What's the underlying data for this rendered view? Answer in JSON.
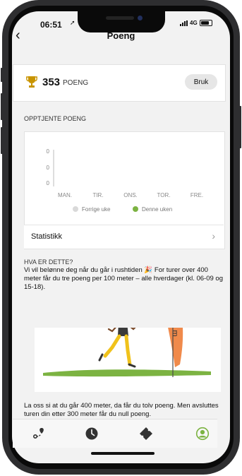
{
  "status_bar": {
    "time": "06:51",
    "network": "4G"
  },
  "nav": {
    "title": "Poeng"
  },
  "points": {
    "value": "353",
    "label": "POENG",
    "button_label": "Bruk"
  },
  "earned": {
    "heading": "OPPTJENTE POENG"
  },
  "chart_data": {
    "type": "bar",
    "categories": [
      "MAN.",
      "TIR.",
      "ONS.",
      "TOR.",
      "FRE."
    ],
    "y_tick_labels": [
      "0",
      "0",
      "0"
    ],
    "series": [
      {
        "name": "Forrige uke",
        "values": [
          0,
          0,
          0,
          0,
          0
        ],
        "color": "#d9d9d9"
      },
      {
        "name": "Denne uken",
        "values": [
          0,
          0,
          0,
          0,
          0
        ],
        "color": "#7cb342"
      }
    ],
    "grid": false,
    "legend": "bottom"
  },
  "statistics": {
    "label": "Statistikk"
  },
  "info": {
    "heading": "HVA ER DETTE?",
    "text_before_emoji": "Vi vil belønne deg når du går i rushtiden",
    "emoji": "🎉",
    "text_after_emoji": "For turer over 400 meter får du tre poeng per 100 meter – alle hverdager (kl. 06-09 og 15-18).",
    "banner_text": "400 m",
    "example_text": "La oss si at du går 400 meter, da får du tolv poeng. Men avsluttes turen din etter 300 meter får du null poeng."
  },
  "tabbar": {
    "tabs": [
      {
        "icon": "route-icon",
        "active": false
      },
      {
        "icon": "clock-icon",
        "active": false
      },
      {
        "icon": "ticket-icon",
        "active": false
      },
      {
        "icon": "profile-icon",
        "active": true
      }
    ]
  },
  "colors": {
    "accent": "#7cb342",
    "trophy": "#c89400",
    "background": "#f2f2f2"
  }
}
